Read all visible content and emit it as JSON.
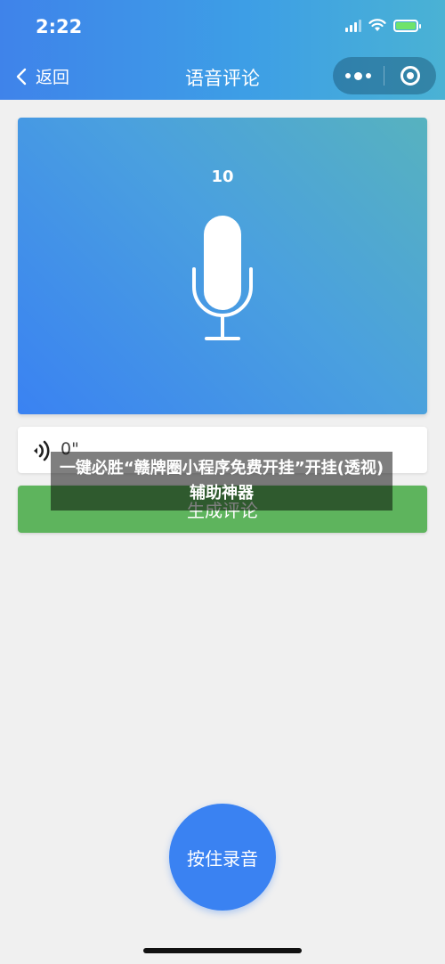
{
  "status_bar": {
    "time": "2:22"
  },
  "nav": {
    "back_label": "返回",
    "title": "语音评论"
  },
  "recorder": {
    "countdown": "10",
    "duration": "0\""
  },
  "generate_button": {
    "label": "生成评论"
  },
  "overlay": {
    "text": "一键必胜“赣牌圈小程序免费开挂”开挂(透视)辅助神器"
  },
  "record_button": {
    "label": "按住录音"
  },
  "colors": {
    "header": "#3f83ea",
    "accent_blue": "#3a82f2",
    "generate_green": "#5eb45d",
    "background": "#f0f0f0"
  },
  "icons": [
    "signal-icon",
    "wifi-icon",
    "battery-charging-icon",
    "back-chevron-icon",
    "more-dots-icon",
    "close-target-icon",
    "microphone-icon",
    "speaker-icon"
  ]
}
